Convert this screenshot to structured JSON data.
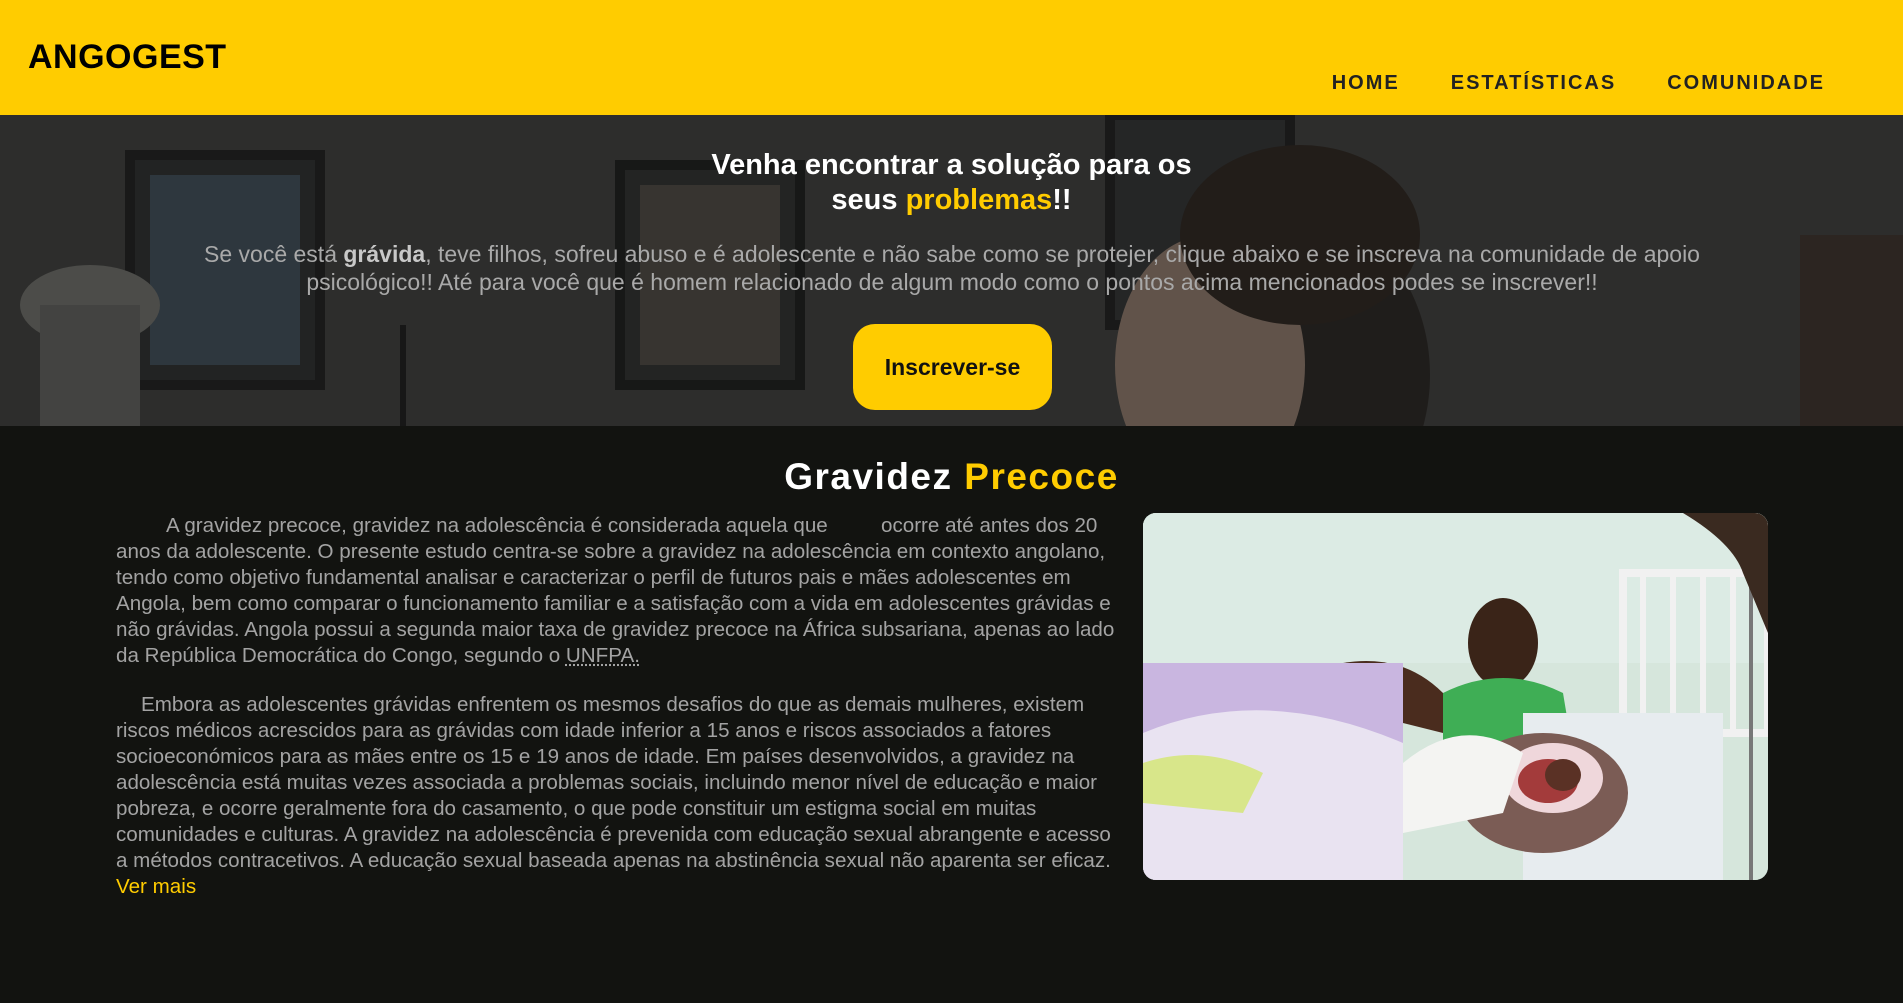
{
  "header": {
    "brand": "ANGOGEST",
    "nav": [
      {
        "label": "HOME"
      },
      {
        "label": "ESTATÍSTICAS"
      },
      {
        "label": "COMUNIDADE"
      }
    ]
  },
  "hero": {
    "title_line1": "Venha encontrar a solução para os",
    "title_line2_pre": "seus ",
    "title_line2_hl": "problemas",
    "title_line2_post": "!!",
    "text_pre": "Se você está ",
    "text_bold": "grávida",
    "text_post": ", teve filhos, sofreu abuso e é adolescente e não sabe como se protejer, clique abaixo e se inscreva na comunidade de apoio psicológico!! Até para você que é homem relacionado de algum modo como o pontos acima mencionados podes se inscrever!!",
    "cta_label": "Inscrever-se"
  },
  "section": {
    "title_pre": "Gravidez ",
    "title_hl": "Precoce",
    "p1_first": "A gravidez precoce, gravidez na adolescência é considerada aquela que",
    "p1_rest": "ocorre até antes dos 20 anos da adolescente. O presente estudo centra-se sobre a gravidez na adolescência em contexto angolano, tendo como objetivo fundamental analisar e caracterizar o perfil de futuros pais e mães adolescentes em Angola, bem como comparar o funcionamento familiar e a satisfação com a vida em adolescentes grávidas e não grávidas. Angola possui a segunda maior taxa de gravidez precoce na África subsariana, apenas ao lado da República Democrática do Congo, segundo o ",
    "p1_link": "UNFPA.",
    "p2": "Embora as adolescentes grávidas enfrentem os mesmos desafios do que as demais mulheres, existem riscos médicos acrescidos para as grávidas com idade inferior a 15 anos e riscos associados a fatores socioeconómicos para as mães entre os 15 e 19 anos de idade. Em países desenvolvidos, a gravidez na adolescência está muitas vezes associada a problemas sociais, incluindo menor nível de educação e maior pobreza, e ocorre geralmente fora do casamento, o que pode constituir um estigma social em muitas comunidades e culturas. A gravidez na adolescência é prevenida com educação sexual abrangente e acesso a métodos contracetivos. A educação sexual baseada apenas na abstinência sexual não aparenta ser eficaz. ",
    "more_link": "Ver mais"
  },
  "colors": {
    "accent": "#ffcc00",
    "dark_bg": "#121310",
    "text_muted": "#a3a3a3"
  }
}
